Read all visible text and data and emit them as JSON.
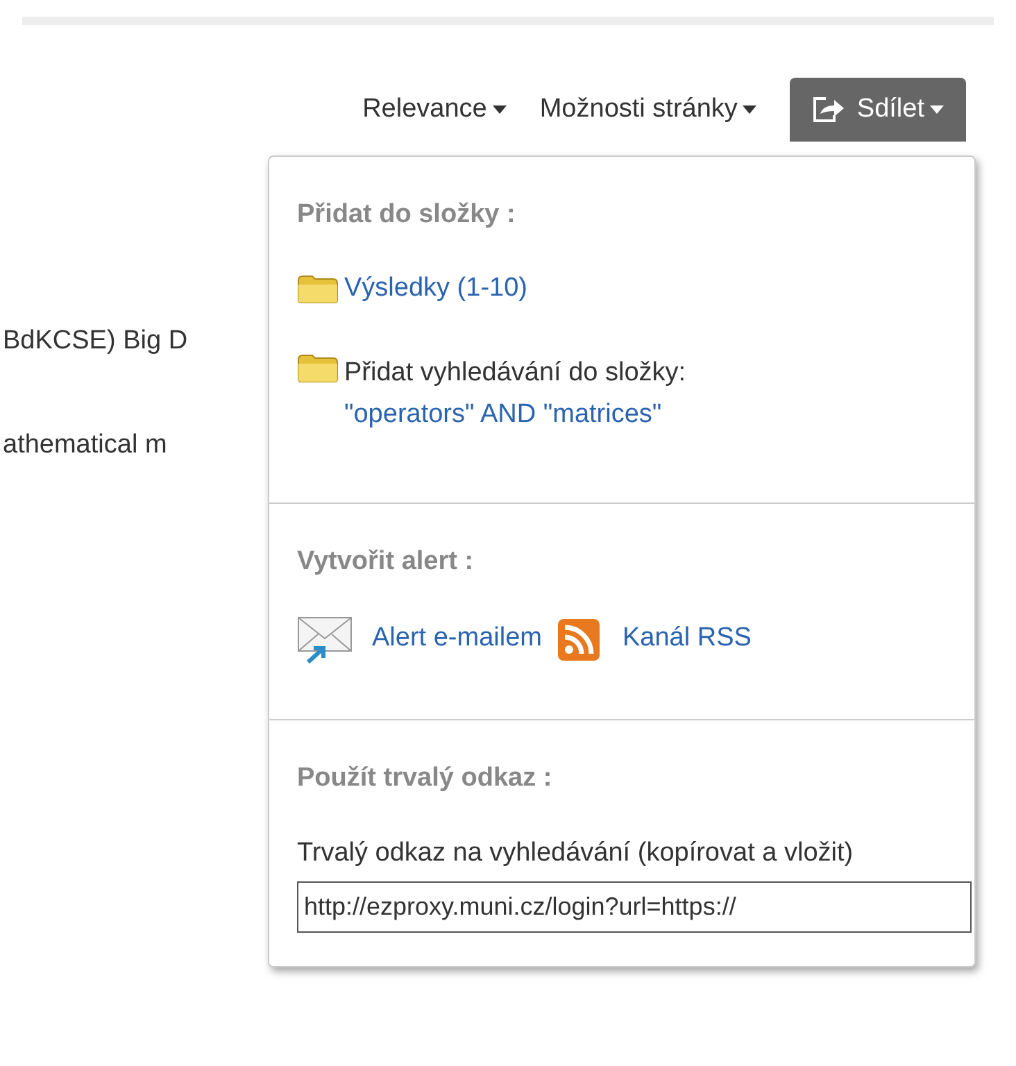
{
  "toolbar": [
    {
      "label": "Relevance",
      "kind": "link"
    },
    {
      "label": "Možnosti stránky",
      "kind": "link"
    },
    {
      "label": "Sdílet",
      "kind": "button",
      "expanded": true
    }
  ],
  "background_results": [
    "BdKCSE) Big D",
    "athematical m"
  ],
  "share_menu": {
    "sections": [
      {
        "heading": "Přidat do složky :",
        "items": [
          {
            "kind": "folder-link",
            "text": "Výsledky (1-10)"
          },
          {
            "kind": "folder-text",
            "text": "Přidat vyhledávání do složky:",
            "link": "\"operators\" AND \"matrices\""
          }
        ]
      },
      {
        "heading": "Vytvořit alert :",
        "items": [
          {
            "kind": "alerts",
            "email": "Alert e-mailem",
            "rss": "Kanál RSS"
          }
        ]
      },
      {
        "heading": "Použít trvalý odkaz :",
        "items": [
          {
            "kind": "permalink",
            "text": "Trvalý odkaz na vyhledávání (kopírovat a vložit)",
            "value": "http://ezproxy.muni.cz/login?url=https://"
          }
        ]
      }
    ]
  }
}
